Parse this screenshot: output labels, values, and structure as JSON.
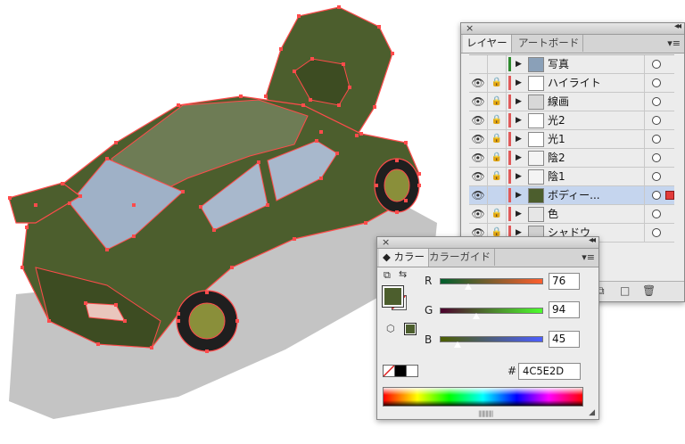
{
  "layers_panel": {
    "tabs": [
      {
        "label": "レイヤー",
        "active": true
      },
      {
        "label": "アートボード",
        "active": false
      }
    ],
    "layers": [
      {
        "name": "写真",
        "visible": false,
        "locked": false,
        "color": "#2e8b2e",
        "selected": false
      },
      {
        "name": "ハイライト",
        "visible": true,
        "locked": true,
        "color": "#e05a5a",
        "selected": false
      },
      {
        "name": "線画",
        "visible": true,
        "locked": true,
        "color": "#e05a5a",
        "selected": false
      },
      {
        "name": "光2",
        "visible": true,
        "locked": true,
        "color": "#e05a5a",
        "selected": false
      },
      {
        "name": "光1",
        "visible": true,
        "locked": true,
        "color": "#e05a5a",
        "selected": false
      },
      {
        "name": "陰2",
        "visible": true,
        "locked": true,
        "color": "#e05a5a",
        "selected": false
      },
      {
        "name": "陰1",
        "visible": true,
        "locked": true,
        "color": "#e05a5a",
        "selected": false
      },
      {
        "name": "ボディー...",
        "visible": true,
        "locked": false,
        "color": "#e05a5a",
        "selected": true
      },
      {
        "name": "色",
        "visible": true,
        "locked": true,
        "color": "#e05a5a",
        "selected": false
      },
      {
        "name": "シャドウ",
        "visible": true,
        "locked": true,
        "color": "#e05a5a",
        "selected": false
      }
    ]
  },
  "color_panel": {
    "tabs": [
      {
        "label": "カラー",
        "active": true
      },
      {
        "label": "カラーガイド",
        "active": false
      }
    ],
    "channels": [
      {
        "label": "R",
        "value": "76"
      },
      {
        "label": "G",
        "value": "94"
      },
      {
        "label": "B",
        "value": "45"
      }
    ],
    "hash_label": "#",
    "hex": "4C5E2D",
    "fill_color": "#4c5e2d"
  },
  "icons": {
    "close": "×",
    "collapse": "◂◂",
    "menu": "▾≡",
    "eye": "👁",
    "lock": "🔒",
    "expand": "▶"
  }
}
